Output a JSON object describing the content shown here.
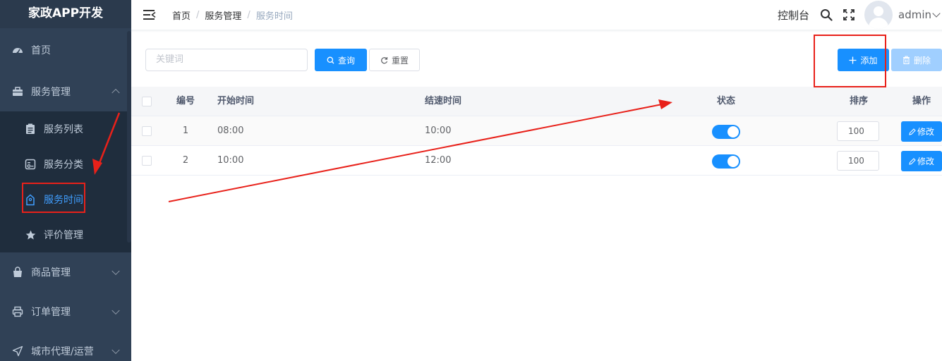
{
  "sidebar": {
    "logo": "家政APP开发",
    "items": [
      {
        "label": "首页",
        "icon": "dashboard-icon"
      },
      {
        "label": "服务管理",
        "icon": "briefcase-icon",
        "expanded": true
      },
      {
        "label": "商品管理",
        "icon": "shopping-bag-icon"
      },
      {
        "label": "订单管理",
        "icon": "printer-icon"
      },
      {
        "label": "城市代理/运营",
        "icon": "send-icon"
      }
    ],
    "submenu": [
      {
        "label": "服务列表",
        "icon": "clipboard-icon"
      },
      {
        "label": "服务分类",
        "icon": "category-icon"
      },
      {
        "label": "服务时间",
        "icon": "tag-icon",
        "active": true
      },
      {
        "label": "评价管理",
        "icon": "star-icon"
      }
    ]
  },
  "header": {
    "breadcrumb": [
      "首页",
      "服务管理",
      "服务时间"
    ],
    "console_label": "控制台",
    "username": "admin"
  },
  "toolbar": {
    "search_placeholder": "关键词",
    "query_label": "查询",
    "reset_label": "重置",
    "add_label": "添加",
    "delete_label": "删除"
  },
  "table": {
    "columns": {
      "id": "编号",
      "start": "开始时间",
      "end": "结速时间",
      "status": "状态",
      "sort": "排序",
      "op": "操作"
    },
    "rows": [
      {
        "id": "1",
        "start": "08:00",
        "end": "10:00",
        "status": true,
        "sort": "100",
        "edit_label": "修改"
      },
      {
        "id": "2",
        "start": "10:00",
        "end": "12:00",
        "status": true,
        "sort": "100",
        "edit_label": "修改"
      }
    ]
  },
  "colors": {
    "primary": "#1890ff",
    "sidebar_bg": "#304156",
    "annotation": "#e8211a"
  }
}
